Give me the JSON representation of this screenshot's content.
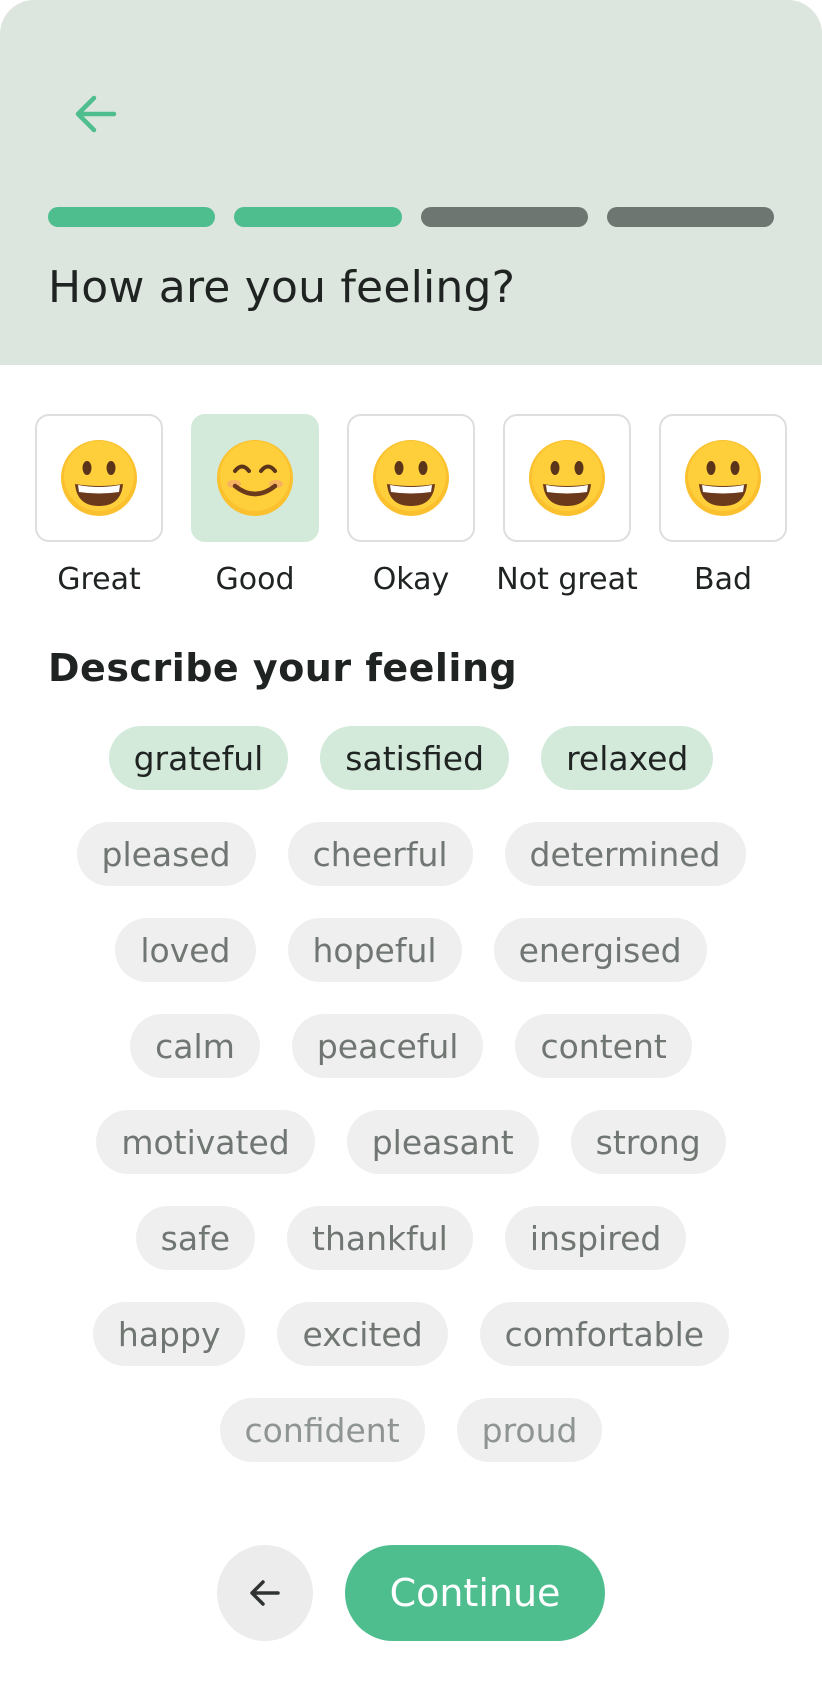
{
  "header": {
    "back_icon": "arrow-left-icon",
    "title": "How are you feeling?",
    "progress": {
      "total_steps": 4,
      "completed_steps": 2
    },
    "colors": {
      "background": "#dce5de",
      "accent": "#4fbe8f",
      "inactive": "#6d7671"
    }
  },
  "moods": [
    {
      "label": "Great",
      "icon": "grinning-face-icon",
      "selected": false
    },
    {
      "label": "Good",
      "icon": "smiling-face-icon",
      "selected": true
    },
    {
      "label": "Okay",
      "icon": "grinning-face-icon",
      "selected": false
    },
    {
      "label": "Not great",
      "icon": "grinning-face-icon",
      "selected": false
    },
    {
      "label": "Bad",
      "icon": "grinning-face-icon",
      "selected": false
    }
  ],
  "describe": {
    "title": "Describe your feeling",
    "tags": [
      {
        "label": "grateful",
        "selected": true
      },
      {
        "label": "satisfied",
        "selected": true
      },
      {
        "label": "relaxed",
        "selected": true
      },
      {
        "label": "pleased",
        "selected": false
      },
      {
        "label": "cheerful",
        "selected": false
      },
      {
        "label": "determined",
        "selected": false
      },
      {
        "label": "loved",
        "selected": false
      },
      {
        "label": "hopeful",
        "selected": false
      },
      {
        "label": "energised",
        "selected": false
      },
      {
        "label": "calm",
        "selected": false
      },
      {
        "label": "peaceful",
        "selected": false
      },
      {
        "label": "content",
        "selected": false
      },
      {
        "label": "motivated",
        "selected": false
      },
      {
        "label": "pleasant",
        "selected": false
      },
      {
        "label": "strong",
        "selected": false
      },
      {
        "label": "safe",
        "selected": false
      },
      {
        "label": "thankful",
        "selected": false
      },
      {
        "label": "inspired",
        "selected": false
      },
      {
        "label": "happy",
        "selected": false
      },
      {
        "label": "excited",
        "selected": false
      },
      {
        "label": "comfortable",
        "selected": false
      },
      {
        "label": "confident",
        "selected": false
      },
      {
        "label": "proud",
        "selected": false
      }
    ]
  },
  "footer": {
    "back_icon": "arrow-left-icon",
    "continue_label": "Continue"
  }
}
